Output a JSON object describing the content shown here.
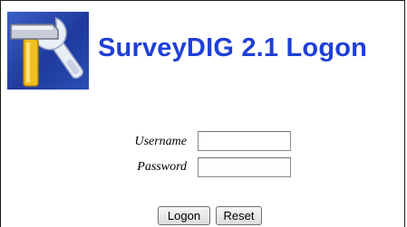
{
  "header": {
    "title": "SurveyDIG 2.1 Logon",
    "logo_icon": "hammer-wrench-tools-icon",
    "title_color": "#1f3fd6"
  },
  "form": {
    "username_label": "Username",
    "username_value": "",
    "password_label": "Password",
    "password_value": ""
  },
  "buttons": {
    "logon_label": "Logon",
    "reset_label": "Reset"
  }
}
